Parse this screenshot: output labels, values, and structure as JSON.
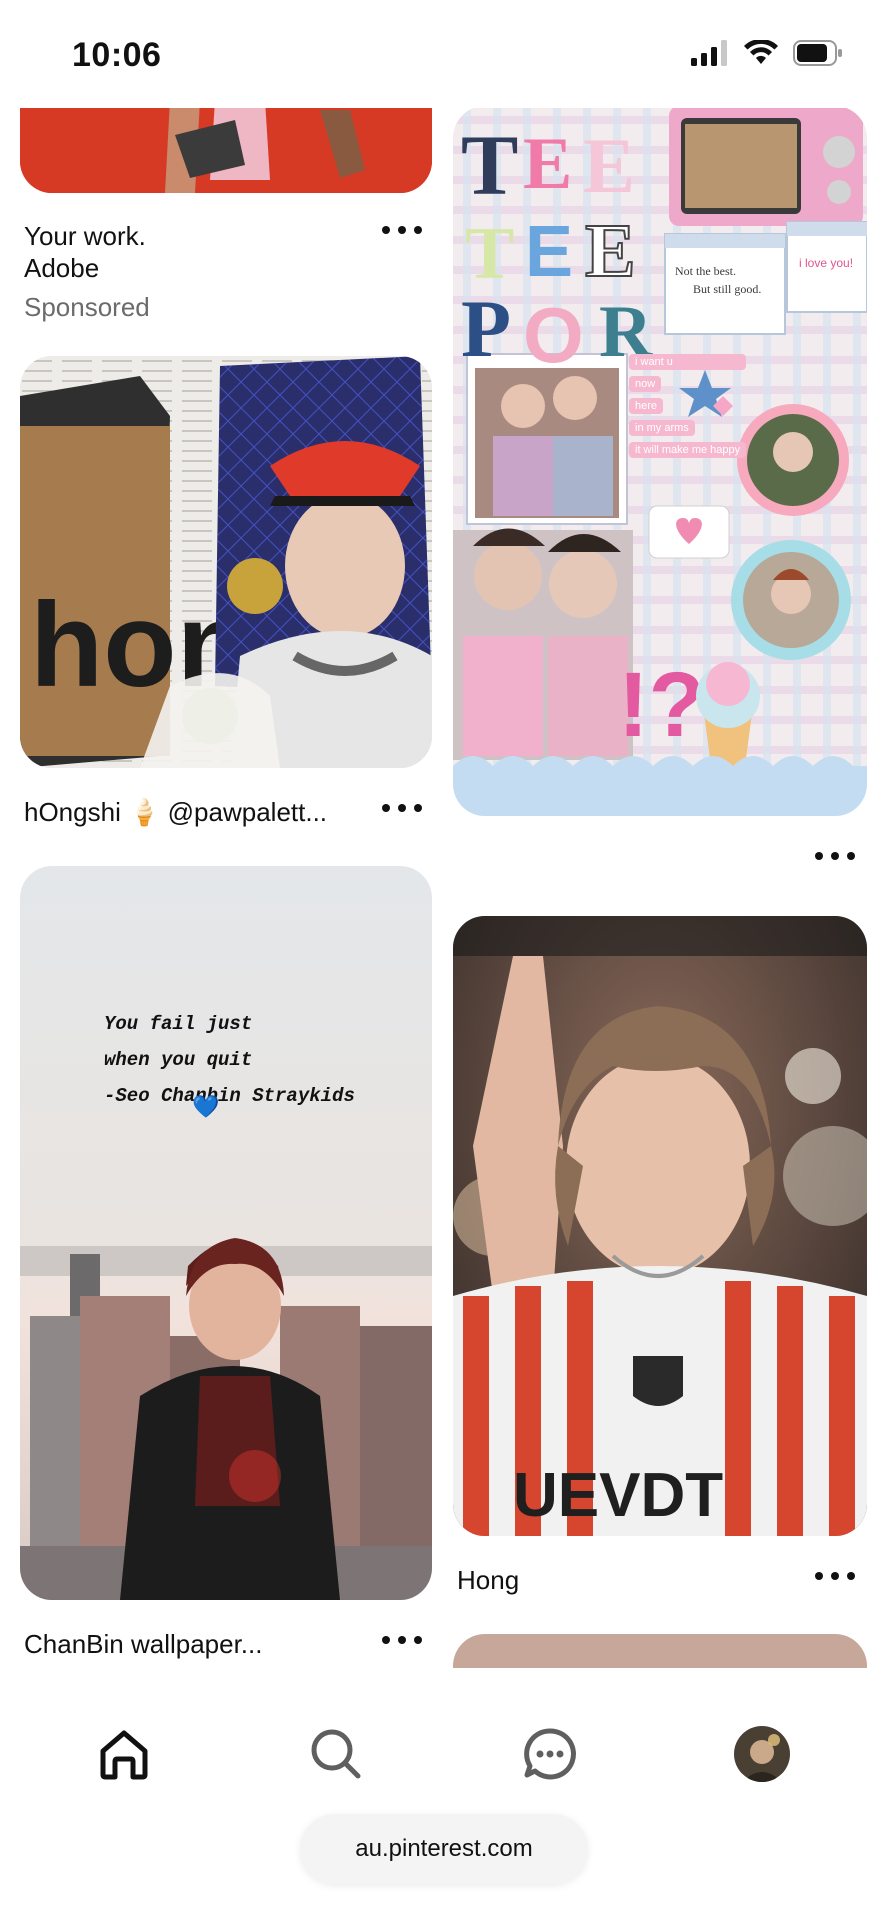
{
  "status_bar": {
    "time": "10:06"
  },
  "feed": {
    "pins": [
      {
        "id": "adobe",
        "title_line1": "Your work.",
        "title_line2": "Adobe",
        "sponsored_label": "Sponsored"
      },
      {
        "id": "collage",
        "title": ""
      },
      {
        "id": "hongshi",
        "title": "hOngshi 🍦 @pawpalett..."
      },
      {
        "id": "chanbin",
        "title": "ChanBin wallpaper...",
        "quote_text": "You fail just\nwhen you quit\n-Seo Chanbin Straykids",
        "quote_heart": "💙"
      },
      {
        "id": "hong",
        "title": "Hong"
      },
      {
        "id": "partial",
        "title": ""
      }
    ],
    "collage_text": {
      "big_letters": "TEE TEE POR",
      "window_text_1": "Not the best.",
      "window_text_2": "But still good.",
      "window_text_3": "i love you!",
      "chat_lines": [
        "i want u",
        "now",
        "here",
        "in my arms",
        "it will make me happy"
      ]
    }
  },
  "bottom_nav": {
    "items": [
      {
        "name": "home",
        "icon": "home-icon"
      },
      {
        "name": "search",
        "icon": "search-icon"
      },
      {
        "name": "messages",
        "icon": "chat-bubble-icon"
      },
      {
        "name": "profile",
        "icon": "avatar"
      }
    ],
    "url": "au.pinterest.com"
  },
  "colors": {
    "accent_red": "#d9301c",
    "nav_icon": "#5f5f5f",
    "pill_bg": "#f4f4f4"
  }
}
